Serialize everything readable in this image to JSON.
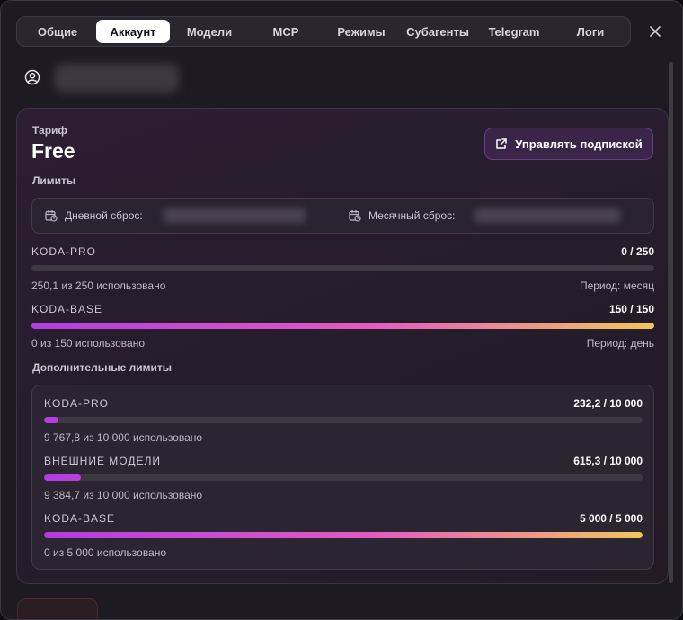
{
  "tabs": [
    {
      "label": "Общие",
      "active": false
    },
    {
      "label": "Аккаунт",
      "active": true
    },
    {
      "label": "Модели",
      "active": false
    },
    {
      "label": "MCP",
      "active": false
    },
    {
      "label": "Режимы",
      "active": false
    },
    {
      "label": "Субагенты",
      "active": false
    },
    {
      "label": "Telegram",
      "active": false
    },
    {
      "label": "Логи",
      "active": false
    }
  ],
  "icons": {
    "close": "close-icon",
    "user": "user-circle-icon",
    "external": "external-link-icon",
    "calendar": "calendar-clock-icon"
  },
  "plan": {
    "label": "Тариф",
    "name": "Free",
    "manage_label": "Управлять подпиской"
  },
  "limits": {
    "title": "Лимиты",
    "daily_reset_label": "Дневной сброс:",
    "monthly_reset_label": "Месячный сброс:",
    "items": [
      {
        "name": "KODA-PRO",
        "count": "0 / 250",
        "usage": "250,1 из 250 использовано",
        "period": "Период: месяц",
        "fill": 0.0
      },
      {
        "name": "KODA-BASE",
        "count": "150 / 150",
        "usage": "0 из 150 использовано",
        "period": "Период: день",
        "fill": 1.0
      }
    ]
  },
  "extra_limits": {
    "title": "Дополнительные лимиты",
    "items": [
      {
        "name": "KODA-PRO",
        "count": "232,2 / 10 000",
        "usage": "9 767,8 из 10 000 использовано",
        "fill": 0.023
      },
      {
        "name": "ВНЕШНИЕ МОДЕЛИ",
        "count": "615,3 / 10 000",
        "usage": "9 384,7 из 10 000 использовано",
        "fill": 0.062
      },
      {
        "name": "KODA-BASE",
        "count": "5 000 / 5 000",
        "usage": "0 из 5 000 использовано",
        "fill": 1.0
      }
    ]
  },
  "colors": {
    "accent": "#b23de0",
    "gradient_mid": "#e45ac2",
    "gradient_end": "#f2c65c",
    "button_bg": "#3a2548"
  }
}
